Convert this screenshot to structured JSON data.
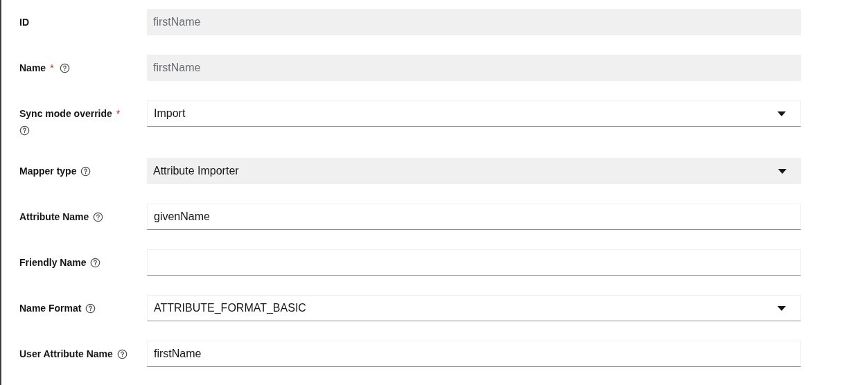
{
  "fields": [
    {
      "label": "ID",
      "help": false,
      "kind": "text",
      "disabled": true,
      "value": "firstName"
    },
    {
      "label": "Name",
      "asterisk": "*",
      "help": true,
      "kind": "text",
      "disabled": true,
      "value": "firstName"
    },
    {
      "label": "Sync mode override",
      "asterisk": "*",
      "help": true,
      "kind": "select",
      "disabled": false,
      "value": "Import"
    },
    {
      "label": "Mapper type",
      "help": true,
      "kind": "select",
      "disabled": true,
      "value": "Attribute Importer"
    },
    {
      "label": "Attribute Name",
      "help": true,
      "kind": "text",
      "disabled": false,
      "value": "givenName"
    },
    {
      "label": "Friendly Name",
      "help": true,
      "kind": "text",
      "disabled": false
    },
    {
      "label": "Name Format",
      "help": true,
      "kind": "select",
      "disabled": false,
      "value": "ATTRIBUTE_FORMAT_BASIC"
    },
    {
      "label": "User Attribute Name",
      "help": true,
      "kind": "text",
      "disabled": false,
      "value": "firstName"
    }
  ]
}
